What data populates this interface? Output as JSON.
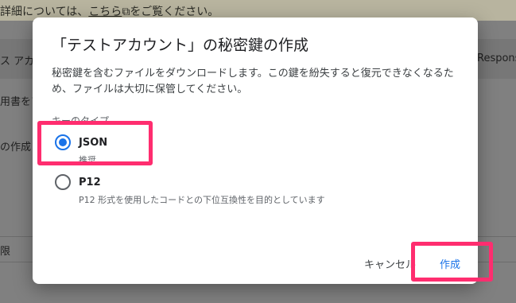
{
  "background": {
    "banner_prefix": "詳細については、",
    "banner_link": "こちら",
    "banner_suffix": "をご覧ください。",
    "header_left": "ス アカ",
    "header_right": "Respons",
    "row1": "用書をア",
    "row2": "の作成",
    "row3": "限"
  },
  "dialog": {
    "title": "「テストアカウント」の秘密鍵の作成",
    "description": "秘密鍵を含むファイルをダウンロードします。この鍵を紛失すると復元できなくなるため、ファイルは大切に保管してください。",
    "key_type_label": "キーのタイプ",
    "options": [
      {
        "label": "JSON",
        "description": "推奨",
        "selected": true
      },
      {
        "label": "P12",
        "description": "P12 形式を使用したコードとの下位互換性を目的としています",
        "selected": false
      }
    ],
    "cancel_label": "キャンセル",
    "create_label": "作成"
  },
  "colors": {
    "accent": "#1a73e8",
    "highlight": "#ff2d6f"
  }
}
